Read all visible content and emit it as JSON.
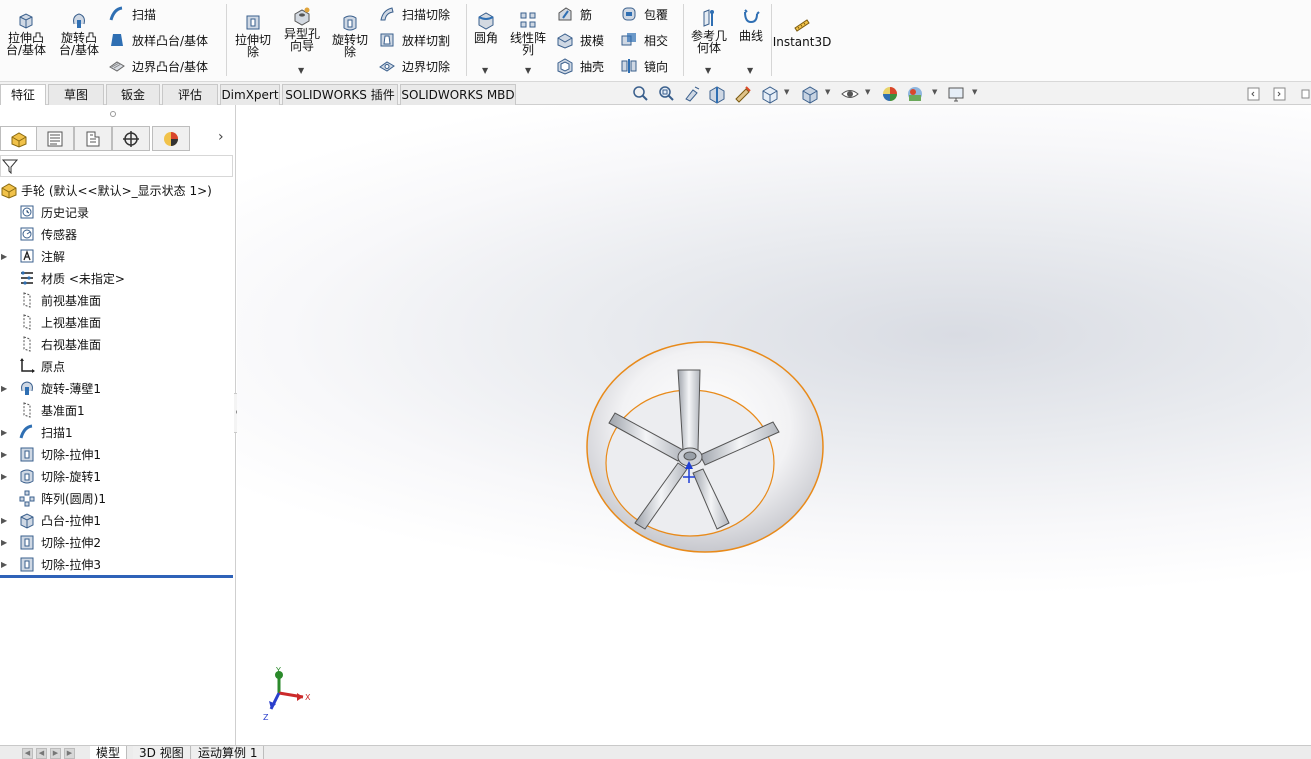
{
  "ribbon": {
    "extrude_boss": "拉伸凸\n台/基体",
    "revolve_boss": "旋转凸\n台/基体",
    "sweep": "扫描",
    "loft_boss": "放样凸台/基体",
    "boundary_boss": "边界凸台/基体",
    "extrude_cut": "拉伸切\n除",
    "hole_wizard": "异型孔\n向导",
    "revolve_cut": "旋转切\n除",
    "sweep_cut": "扫描切除",
    "loft_cut": "放样切割",
    "boundary_cut": "边界切除",
    "fillet": "圆角",
    "linear_pattern": "线性阵\n列",
    "rib": "筋",
    "draft": "拔模",
    "shell": "抽壳",
    "wrap": "包覆",
    "intersect": "相交",
    "mirror": "镜向",
    "reference_geometry": "参考几\n何体",
    "curves": "曲线",
    "instant3d": "Instant3D"
  },
  "tabs": [
    "特征",
    "草图",
    "钣金",
    "评估",
    "DimXpert",
    "SOLIDWORKS 插件",
    "SOLIDWORKS MBD"
  ],
  "feature_tree": {
    "root": "手轮 (默认<<默认>_显示状态 1>)",
    "items": [
      {
        "label": "历史记录",
        "icon": "history-icon",
        "expandable": false
      },
      {
        "label": "传感器",
        "icon": "sensor-icon",
        "expandable": false
      },
      {
        "label": "注解",
        "icon": "annotation-icon",
        "expandable": true
      },
      {
        "label": "材质 <未指定>",
        "icon": "material-icon",
        "expandable": false
      },
      {
        "label": "前视基准面",
        "icon": "plane-icon",
        "expandable": false
      },
      {
        "label": "上视基准面",
        "icon": "plane-icon",
        "expandable": false
      },
      {
        "label": "右视基准面",
        "icon": "plane-icon",
        "expandable": false
      },
      {
        "label": "原点",
        "icon": "origin-icon",
        "expandable": false
      },
      {
        "label": "旋转-薄壁1",
        "icon": "revolve-icon",
        "expandable": true
      },
      {
        "label": "基准面1",
        "icon": "plane-icon",
        "expandable": false
      },
      {
        "label": "扫描1",
        "icon": "sweep-icon",
        "expandable": true
      },
      {
        "label": "切除-拉伸1",
        "icon": "extrude-cut-icon",
        "expandable": true
      },
      {
        "label": "切除-旋转1",
        "icon": "revolve-cut-icon",
        "expandable": true
      },
      {
        "label": "阵列(圆周)1",
        "icon": "circular-pattern-icon",
        "expandable": false
      },
      {
        "label": "凸台-拉伸1",
        "icon": "extrude-boss-icon",
        "expandable": true
      },
      {
        "label": "切除-拉伸2",
        "icon": "extrude-cut-icon",
        "expandable": true
      },
      {
        "label": "切除-拉伸3",
        "icon": "extrude-cut-icon",
        "expandable": true
      }
    ]
  },
  "triad": {
    "x": "X",
    "y": "Y",
    "z": "Z"
  },
  "bottom_tabs": [
    "模型",
    "3D 视图",
    "运动算例 1"
  ],
  "colors": {
    "accent_orange": "#e88a1a",
    "rollback_blue": "#2f62b8",
    "icon_blue": "#2f6fb3"
  }
}
